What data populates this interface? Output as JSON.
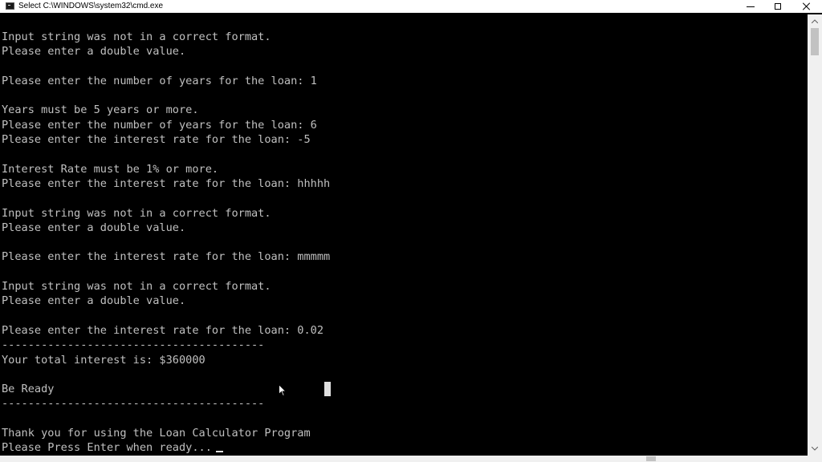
{
  "window": {
    "title": "Select C:\\WINDOWS\\system32\\cmd.exe",
    "icon": "cmd-icon",
    "controls": {
      "minimize": "minimize-icon",
      "maximize": "maximize-icon",
      "close": "close-icon"
    }
  },
  "console": {
    "foreground": "#c0c0c0",
    "background": "#000000",
    "lines": [
      "Input string was not in a correct format.",
      "Please enter a double value.",
      "",
      "Please enter the number of years for the loan: 1",
      "",
      "Years must be 5 years or more.",
      "Please enter the number of years for the loan: 6",
      "Please enter the interest rate for the loan: -5",
      "",
      "Interest Rate must be 1% or more.",
      "Please enter the interest rate for the loan: hhhhh",
      "",
      "Input string was not in a correct format.",
      "Please enter a double value.",
      "",
      "Please enter the interest rate for the loan: mmmmm",
      "",
      "Input string was not in a correct format.",
      "Please enter a double value.",
      "",
      "Please enter the interest rate for the loan: 0.02",
      "----------------------------------------",
      "Your total interest is: $360000",
      "",
      "Be Ready",
      "----------------------------------------",
      "",
      "Thank you for using the Loan Calculator Program",
      "Please Press Enter when ready..."
    ]
  }
}
